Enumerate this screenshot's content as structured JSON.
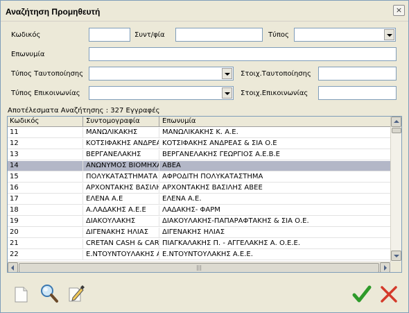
{
  "window": {
    "title": "Αναζήτηση Προμηθευτή",
    "close_glyph": "×"
  },
  "form": {
    "code_label": "Κωδικός",
    "code_value": "",
    "abbr_label": "Συντ/φία",
    "abbr_value": "",
    "type_label": "Τύπος",
    "type_value": "",
    "name_label": "Επωνυμία",
    "name_value": "",
    "id_type_label": "Τύπος Ταυτοποίησης",
    "id_type_value": "",
    "id_data_label": "Στοιχ.Ταυτοποίησης",
    "id_data_value": "",
    "contact_type_label": "Τύπος Επικοινωνίας",
    "contact_type_value": "",
    "contact_data_label": "Στοιχ.Επικοινωνίας",
    "contact_data_value": ""
  },
  "results": {
    "summary": "Αποτέλεσματα Αναζήτησης : 327 Εγγραφές",
    "columns": [
      "Κωδικός",
      "Συντομογραφία",
      "Επωνυμία"
    ],
    "selected_index": 3,
    "rows": [
      [
        "11",
        "ΜΑΝΩΛΙΚΑΚΗΣ",
        "ΜΑΝΩΛΙΚΑΚΗΣ Κ. Α.Ε."
      ],
      [
        "12",
        "ΚΟΤΣΙΦΑΚΗΣ ΑΝΔΡΕΑΣ",
        "ΚΟΤΣΙΦΑΚΗΣ ΑΝΔΡΕΑΣ &  ΣΙΑ Ο.Ε"
      ],
      [
        "13",
        "ΒΕΡΓΑΝΕΛΑΚΗΣ",
        "ΒΕΡΓΑΝΕΛΑΚΗΣ ΓΕΩΡΓΙΟΣ Α.Ε.Β.Ε"
      ],
      [
        "14",
        "ΑΝΩΝΥΜΟΣ ΒΙΟΜΗΧΑΝΙΑ",
        "ΑΒΕΑ"
      ],
      [
        "15",
        "ΠΟΛΥΚΑΤΑΣΤΗΜΑΤΑ",
        "ΑΦΡΟΔΙΤΗ ΠΟΛΥΚΑΤΑΣΤΗΜΑ"
      ],
      [
        "16",
        "ΑΡΧΟΝΤΑΚΗΣ ΒΑΣΙΛΗΣ",
        "ΑΡΧΟΝΤΑΚΗΣ ΒΑΣΙΛΗΣ ΑΒΕΕ"
      ],
      [
        "17",
        "ΕΛΕΝΑ Α.Ε",
        "ΕΛΕΝΑ Α.Ε."
      ],
      [
        "18",
        "Α.ΛΑΔΑΚΗΣ Α.Ε.Ε",
        "ΛΑΔΑΚΗΣ- ΦΑΡΜ"
      ],
      [
        "19",
        "ΔΙΑΚΟΥΛΑΚΗΣ",
        "ΔΙΑΚΟΥΛΑΚΗΣ-ΠΑΠΑΡΑΦΤΑΚΗΣ & ΣΙΑ Ο.Ε."
      ],
      [
        "20",
        "ΔΙΓΕΝΑΚΗΣ ΗΛΙΑΣ",
        "ΔΙΓΕΝΑΚΗΣ ΗΛΙΑΣ"
      ],
      [
        "21",
        "CRETAN CASH & CARRY",
        "ΠΙΑΓΚΑΛΑΚΗΣ Π. - ΑΓΓΕΛΑΚΗΣ Α. Ο.Ε.Ε."
      ],
      [
        "22",
        "Ε.ΝΤΟΥΝΤΟΥΛΑΚΗΣ Α.Ε.",
        "Ε.ΝΤΟΥΝΤΟΥΛΑΚΗΣ Α.Ε.Ε."
      ]
    ]
  },
  "toolbar": {
    "new_icon": "new-document-icon",
    "search_icon": "magnifier-icon",
    "edit_icon": "edit-pencil-icon",
    "ok_icon": "checkmark-icon",
    "cancel_icon": "x-icon",
    "ok_color": "#2e9a2a",
    "cancel_color": "#d43a2a"
  },
  "colors": {
    "window_bg": "#ece9d8",
    "selected_row": "#b3b7c7",
    "field_border": "#7f9db9"
  }
}
